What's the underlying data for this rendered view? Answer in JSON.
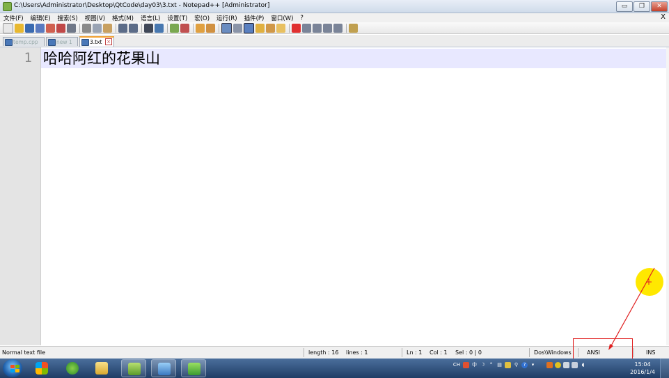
{
  "window": {
    "title": "C:\\Users\\Administrator\\Desktop\\QtCode\\day03\\3.txt - Notepad++ [Administrator]",
    "buttons": {
      "minimize": "▭",
      "restore": "❐",
      "close": "✕"
    }
  },
  "menubar": {
    "items": [
      "文件(F)",
      "编辑(E)",
      "搜索(S)",
      "视图(V)",
      "格式(M)",
      "语言(L)",
      "设置(T)",
      "宏(O)",
      "运行(R)",
      "插件(P)",
      "窗口(W)",
      "?"
    ],
    "close_label": "X"
  },
  "tabs": [
    {
      "label": "temp.cpp",
      "active": false
    },
    {
      "label": "new 1",
      "active": false
    },
    {
      "label": "3.txt",
      "active": true
    }
  ],
  "editor": {
    "line_number": "1",
    "text": "哈哈阿红的花果山"
  },
  "statusbar": {
    "file_type": "Normal text file",
    "length": "length : 16",
    "lines": "lines : 1",
    "ln": "Ln : 1",
    "col": "Col : 1",
    "sel": "Sel : 0 | 0",
    "eol": "Dos\\Windows",
    "encoding": "ANSI",
    "mode": "INS"
  },
  "taskbar": {
    "clock_time": "15:04",
    "clock_date": "2016/1/4",
    "tray_lang": "CH"
  },
  "colors": {
    "annotation": "#e02020",
    "cursor_highlight": "#ffe800",
    "current_line": "#e8e8ff"
  }
}
